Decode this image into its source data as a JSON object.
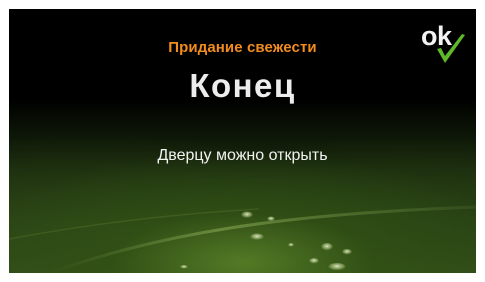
{
  "screen": {
    "title": "Придание свежести",
    "status": "Конец",
    "message": "Дверцу можно открыть"
  },
  "ok_button": {
    "label": "ok",
    "icon": "checkmark-icon",
    "check_color": "#5fb82a"
  },
  "colors": {
    "title": "#f28c1e",
    "text": "#ededed",
    "background": "#000000"
  }
}
